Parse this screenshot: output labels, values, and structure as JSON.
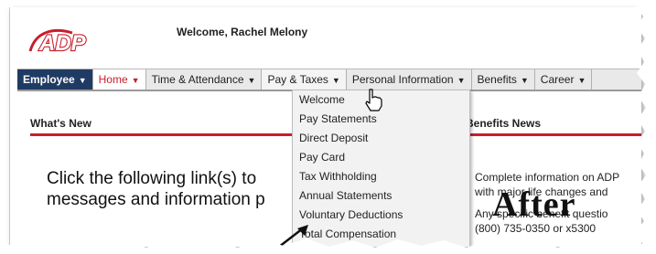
{
  "header": {
    "logo_text": "ADP",
    "welcome": "Welcome, Rachel Melony"
  },
  "nav": [
    {
      "label": "Employee",
      "caret": "▼"
    },
    {
      "label": "Home",
      "caret": "▼"
    },
    {
      "label": "Time & Attendance",
      "caret": "▼"
    },
    {
      "label": "Pay & Taxes",
      "caret": "▼"
    },
    {
      "label": "Personal Information",
      "caret": "▼"
    },
    {
      "label": "Benefits",
      "caret": "▼"
    },
    {
      "label": "Career",
      "caret": "▼"
    }
  ],
  "dropdown": [
    "Welcome",
    "Pay Statements",
    "Direct Deposit",
    "Pay Card",
    "Tax Withholding",
    "Annual Statements",
    "Voluntary Deductions",
    "Total Compensation"
  ],
  "left_panel": {
    "title": "What's New",
    "line1": "Click the following link(s) to",
    "line2": "messages and information p"
  },
  "right_panel": {
    "title": "Benefits News",
    "line1": "Complete information on ADP",
    "line2": "with major life changes and",
    "line3": "Any specific benefit questio",
    "line4": "(800) 735-0350 or x5300"
  },
  "overlay": {
    "after_label": "After"
  },
  "colors": {
    "brand_red": "#c81e2a",
    "nav_dark": "#1f3b63"
  }
}
